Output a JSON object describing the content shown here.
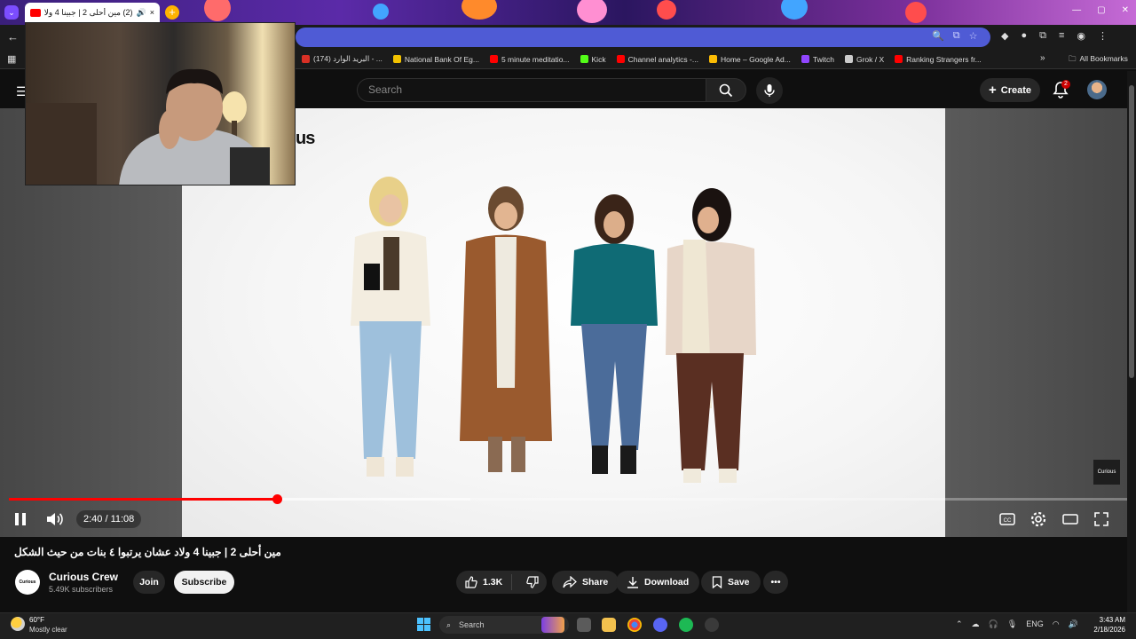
{
  "browser": {
    "tab_title": "(2) مين أحلى 2 | جبينا 4 ولاد",
    "tab_close": "×",
    "new_tab": "+",
    "bookmarks": [
      {
        "label": "(174) البريد الوارد - ...",
        "color": "#d93025"
      },
      {
        "label": "National Bank Of Eg...",
        "color": "#f2c200"
      },
      {
        "label": "5 minute meditatio...",
        "color": "#ff0000"
      },
      {
        "label": "Kick",
        "color": "#53fc18"
      },
      {
        "label": "Channel analytics -...",
        "color": "#ff0000"
      },
      {
        "label": "Home – Google Ad...",
        "color": "#fbbc04"
      },
      {
        "label": "Twitch",
        "color": "#9146ff"
      },
      {
        "label": "Grok / X",
        "color": "#cccccc"
      },
      {
        "label": "Ranking Strangers fr...",
        "color": "#ff0000"
      }
    ],
    "all_bookmarks": "All Bookmarks",
    "more_bookmarks": "»"
  },
  "youtube": {
    "search_placeholder": "Search",
    "create_label": "Create",
    "notification_count": "2"
  },
  "video": {
    "brand_fragment": "us",
    "badge": "Curious",
    "current_time": "2:40",
    "duration": "11:08",
    "time_display": "2:40 / 11:08",
    "progress_fraction": 0.2395,
    "title": "مين أحلى 2 | جبينا 4 ولاد عشان يرتبوا ٤ بنات من حيث الشكل"
  },
  "channel": {
    "avatar_text": "Curious",
    "name": "Curious Crew",
    "subscribers": "5.49K subscribers",
    "join": "Join",
    "subscribe": "Subscribe"
  },
  "actions": {
    "likes": "1.3K",
    "share": "Share",
    "download": "Download",
    "save": "Save",
    "more": "•••"
  },
  "taskbar": {
    "temperature": "60°F",
    "weather": "Mostly clear",
    "search_placeholder": "Search",
    "language": "ENG",
    "time": "3:43 AM",
    "date": "2/18/2026"
  },
  "colors": {
    "accent": "#ff0000",
    "omnibox": "#4f5bd5",
    "background": "#0f0f0f"
  }
}
